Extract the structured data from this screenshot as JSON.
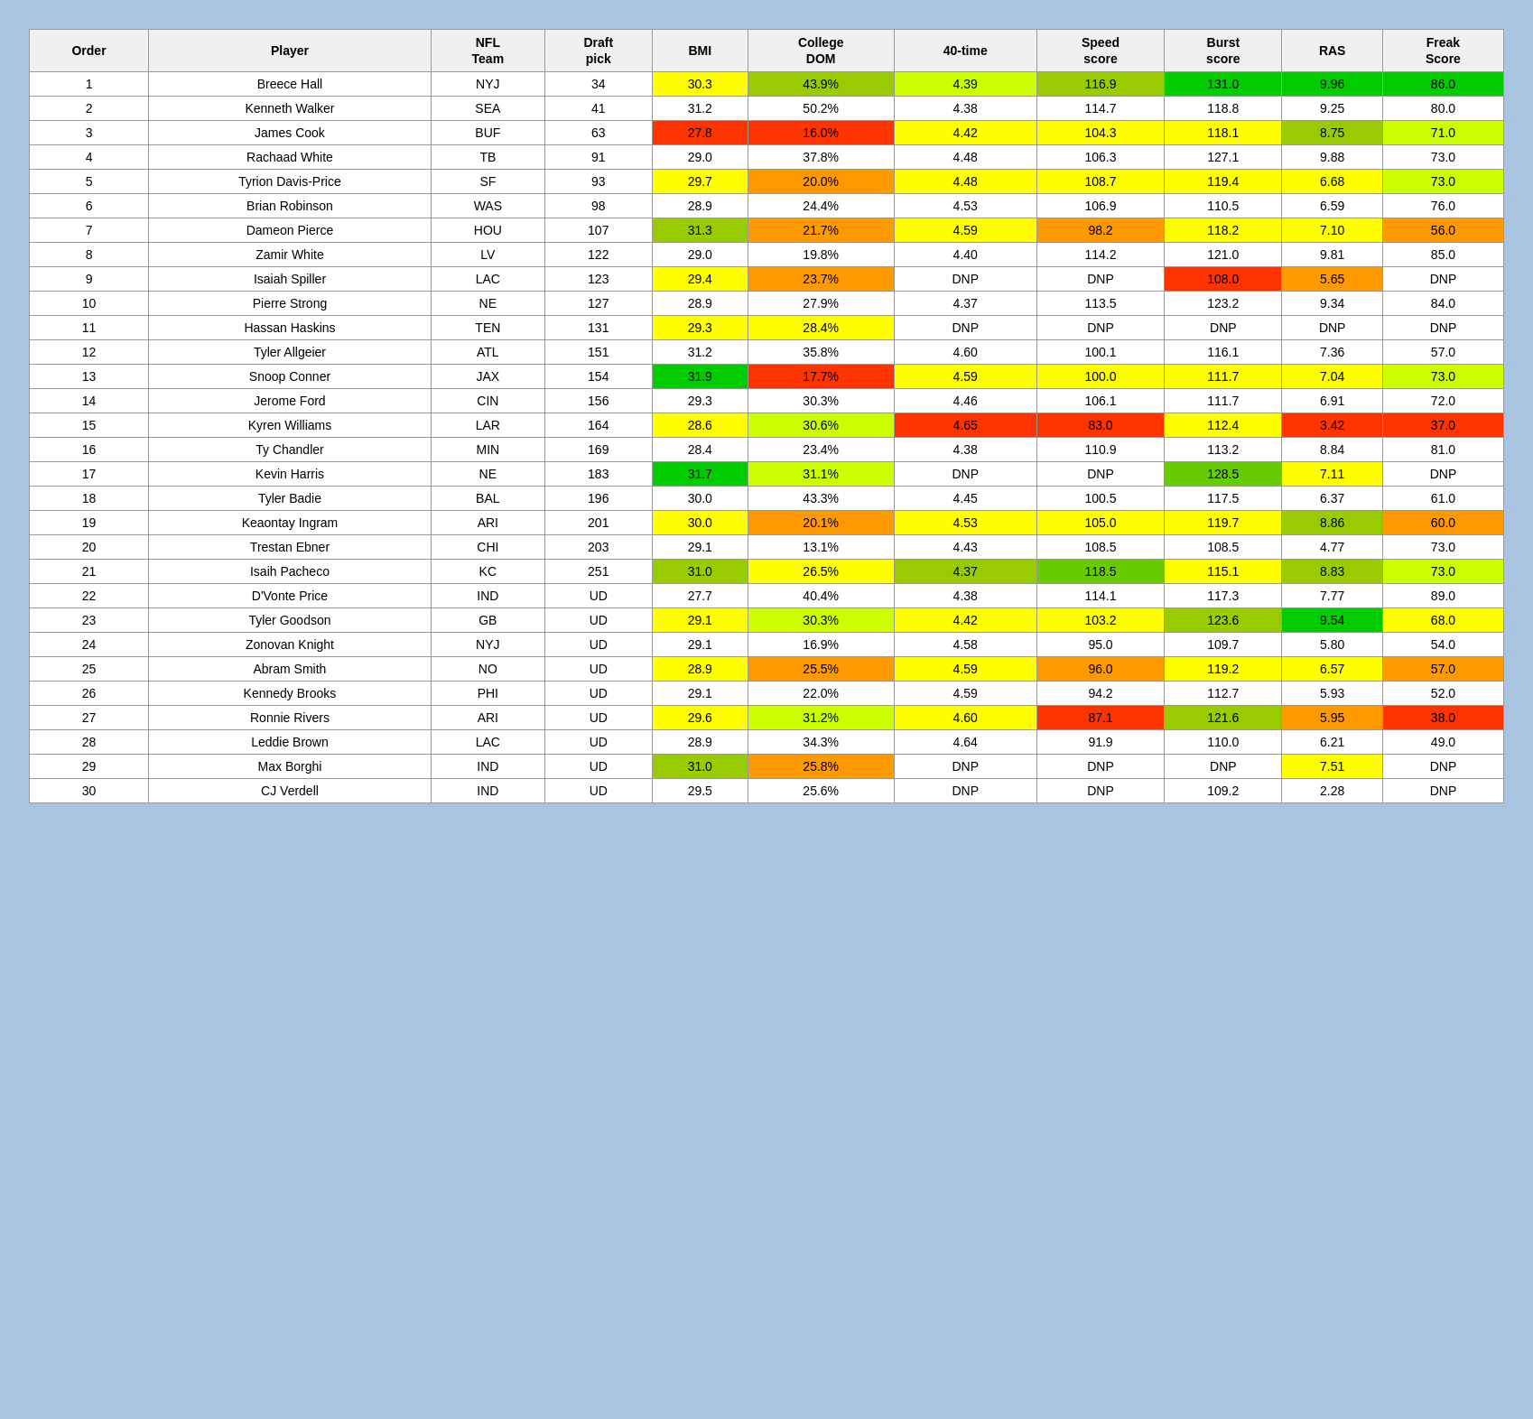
{
  "table": {
    "headers": [
      "Order",
      "Player",
      "NFL Team",
      "Draft pick",
      "BMI",
      "College DOM",
      "40-time",
      "Speed score",
      "Burst score",
      "RAS",
      "Freak Score"
    ],
    "rows": [
      {
        "order": 1,
        "player": "Breece Hall",
        "team": "NYJ",
        "pick": "34",
        "bmi": "30.3",
        "coldom": "43.9%",
        "time40": "4.39",
        "speed": "116.9",
        "burst": "131.0",
        "ras": "9.96",
        "freak": "86.0",
        "bmi_cls": "cell-yellow",
        "coldom_cls": "cell-green-light",
        "time40_cls": "cell-yellow-green",
        "speed_cls": "cell-green-light",
        "burst_cls": "cell-green-strong",
        "ras_cls": "cell-green-strong",
        "freak_cls": "cell-green-strong"
      },
      {
        "order": 2,
        "player": "Kenneth Walker",
        "team": "SEA",
        "pick": "41",
        "bmi": "31.2",
        "coldom": "50.2%",
        "time40": "4.38",
        "speed": "114.7",
        "burst": "118.8",
        "ras": "9.25",
        "freak": "80.0",
        "bmi_cls": "cell-green-light",
        "coldom_cls": "cell-green-strong",
        "time40_cls": "cell-yellow-green",
        "speed_cls": "cell-green-light",
        "burst_cls": "cell-yellow",
        "ras_cls": "cell-green-strong",
        "freak_cls": "cell-green-med"
      },
      {
        "order": 3,
        "player": "James Cook",
        "team": "BUF",
        "pick": "63",
        "bmi": "27.8",
        "coldom": "16.0%",
        "time40": "4.42",
        "speed": "104.3",
        "burst": "118.1",
        "ras": "8.75",
        "freak": "71.0",
        "bmi_cls": "cell-red",
        "coldom_cls": "cell-red",
        "time40_cls": "cell-yellow",
        "speed_cls": "cell-yellow",
        "burst_cls": "cell-yellow",
        "ras_cls": "cell-green-light",
        "freak_cls": "cell-yellow-green"
      },
      {
        "order": 4,
        "player": "Rachaad White",
        "team": "TB",
        "pick": "91",
        "bmi": "29.0",
        "coldom": "37.8%",
        "time40": "4.48",
        "speed": "106.3",
        "burst": "127.1",
        "ras": "9.88",
        "freak": "73.0",
        "bmi_cls": "cell-yellow",
        "coldom_cls": "cell-green-light",
        "time40_cls": "cell-yellow",
        "speed_cls": "cell-yellow",
        "burst_cls": "cell-green-med",
        "ras_cls": "cell-green-strong",
        "freak_cls": "cell-yellow-green"
      },
      {
        "order": 5,
        "player": "Tyrion Davis-Price",
        "team": "SF",
        "pick": "93",
        "bmi": "29.7",
        "coldom": "20.0%",
        "time40": "4.48",
        "speed": "108.7",
        "burst": "119.4",
        "ras": "6.68",
        "freak": "73.0",
        "bmi_cls": "cell-yellow",
        "coldom_cls": "cell-orange",
        "time40_cls": "cell-yellow",
        "speed_cls": "cell-yellow",
        "burst_cls": "cell-yellow",
        "ras_cls": "cell-yellow",
        "freak_cls": "cell-yellow-green"
      },
      {
        "order": 6,
        "player": "Brian Robinson",
        "team": "WAS",
        "pick": "98",
        "bmi": "28.9",
        "coldom": "24.4%",
        "time40": "4.53",
        "speed": "106.9",
        "burst": "110.5",
        "ras": "6.59",
        "freak": "76.0",
        "bmi_cls": "cell-yellow",
        "coldom_cls": "cell-orange",
        "time40_cls": "cell-yellow",
        "speed_cls": "cell-yellow",
        "burst_cls": "cell-yellow",
        "ras_cls": "cell-yellow",
        "freak_cls": "cell-green-light"
      },
      {
        "order": 7,
        "player": "Dameon Pierce",
        "team": "HOU",
        "pick": "107",
        "bmi": "31.3",
        "coldom": "21.7%",
        "time40": "4.59",
        "speed": "98.2",
        "burst": "118.2",
        "ras": "7.10",
        "freak": "56.0",
        "bmi_cls": "cell-green-light",
        "coldom_cls": "cell-orange",
        "time40_cls": "cell-yellow",
        "speed_cls": "cell-orange",
        "burst_cls": "cell-yellow",
        "ras_cls": "cell-yellow",
        "freak_cls": "cell-orange"
      },
      {
        "order": 8,
        "player": "Zamir White",
        "team": "LV",
        "pick": "122",
        "bmi": "29.0",
        "coldom": "19.8%",
        "time40": "4.40",
        "speed": "114.2",
        "burst": "121.0",
        "ras": "9.81",
        "freak": "85.0",
        "bmi_cls": "cell-yellow",
        "coldom_cls": "cell-orange",
        "time40_cls": "cell-yellow-green",
        "speed_cls": "cell-green-light",
        "burst_cls": "cell-green-light",
        "ras_cls": "cell-green-strong",
        "freak_cls": "cell-green-strong"
      },
      {
        "order": 9,
        "player": "Isaiah Spiller",
        "team": "LAC",
        "pick": "123",
        "bmi": "29.4",
        "coldom": "23.7%",
        "time40": "DNP",
        "speed": "DNP",
        "burst": "108.0",
        "ras": "5.65",
        "freak": "DNP",
        "bmi_cls": "cell-yellow",
        "coldom_cls": "cell-orange",
        "time40_cls": "cell-white",
        "speed_cls": "cell-white",
        "burst_cls": "cell-red",
        "ras_cls": "cell-orange",
        "freak_cls": "cell-white"
      },
      {
        "order": 10,
        "player": "Pierre Strong",
        "team": "NE",
        "pick": "127",
        "bmi": "28.9",
        "coldom": "27.9%",
        "time40": "4.37",
        "speed": "113.5",
        "burst": "123.2",
        "ras": "9.34",
        "freak": "84.0",
        "bmi_cls": "cell-yellow",
        "coldom_cls": "cell-yellow",
        "time40_cls": "cell-green-light",
        "speed_cls": "cell-yellow",
        "burst_cls": "cell-green-light",
        "ras_cls": "cell-green-strong",
        "freak_cls": "cell-green-strong"
      },
      {
        "order": 11,
        "player": "Hassan Haskins",
        "team": "TEN",
        "pick": "131",
        "bmi": "29.3",
        "coldom": "28.4%",
        "time40": "DNP",
        "speed": "DNP",
        "burst": "DNP",
        "ras": "DNP",
        "freak": "DNP",
        "bmi_cls": "cell-yellow",
        "coldom_cls": "cell-yellow",
        "time40_cls": "cell-white",
        "speed_cls": "cell-white",
        "burst_cls": "cell-white",
        "ras_cls": "cell-white",
        "freak_cls": "cell-white"
      },
      {
        "order": 12,
        "player": "Tyler Allgeier",
        "team": "ATL",
        "pick": "151",
        "bmi": "31.2",
        "coldom": "35.8%",
        "time40": "4.60",
        "speed": "100.1",
        "burst": "116.1",
        "ras": "7.36",
        "freak": "57.0",
        "bmi_cls": "cell-green-light",
        "coldom_cls": "cell-green-light",
        "time40_cls": "cell-yellow",
        "speed_cls": "cell-yellow",
        "burst_cls": "cell-yellow",
        "ras_cls": "cell-yellow",
        "freak_cls": "cell-orange"
      },
      {
        "order": 13,
        "player": "Snoop Conner",
        "team": "JAX",
        "pick": "154",
        "bmi": "31.9",
        "coldom": "17.7%",
        "time40": "4.59",
        "speed": "100.0",
        "burst": "111.7",
        "ras": "7.04",
        "freak": "73.0",
        "bmi_cls": "cell-green-strong",
        "coldom_cls": "cell-red",
        "time40_cls": "cell-yellow",
        "speed_cls": "cell-yellow",
        "burst_cls": "cell-yellow",
        "ras_cls": "cell-yellow",
        "freak_cls": "cell-yellow-green"
      },
      {
        "order": 14,
        "player": "Jerome Ford",
        "team": "CIN",
        "pick": "156",
        "bmi": "29.3",
        "coldom": "30.3%",
        "time40": "4.46",
        "speed": "106.1",
        "burst": "111.7",
        "ras": "6.91",
        "freak": "72.0",
        "bmi_cls": "cell-yellow",
        "coldom_cls": "cell-yellow-green",
        "time40_cls": "cell-yellow",
        "speed_cls": "cell-yellow",
        "burst_cls": "cell-yellow",
        "ras_cls": "cell-yellow",
        "freak_cls": "cell-yellow-green"
      },
      {
        "order": 15,
        "player": "Kyren Williams",
        "team": "LAR",
        "pick": "164",
        "bmi": "28.6",
        "coldom": "30.6%",
        "time40": "4.65",
        "speed": "83.0",
        "burst": "112.4",
        "ras": "3.42",
        "freak": "37.0",
        "bmi_cls": "cell-yellow",
        "coldom_cls": "cell-yellow-green",
        "time40_cls": "cell-red",
        "speed_cls": "cell-red",
        "burst_cls": "cell-yellow",
        "ras_cls": "cell-red",
        "freak_cls": "cell-red"
      },
      {
        "order": 16,
        "player": "Ty Chandler",
        "team": "MIN",
        "pick": "169",
        "bmi": "28.4",
        "coldom": "23.4%",
        "time40": "4.38",
        "speed": "110.9",
        "burst": "113.2",
        "ras": "8.84",
        "freak": "81.0",
        "bmi_cls": "cell-orange",
        "coldom_cls": "cell-orange",
        "time40_cls": "cell-yellow-green",
        "speed_cls": "cell-yellow",
        "burst_cls": "cell-yellow",
        "ras_cls": "cell-green-light",
        "freak_cls": "cell-green-strong"
      },
      {
        "order": 17,
        "player": "Kevin Harris",
        "team": "NE",
        "pick": "183",
        "bmi": "31.7",
        "coldom": "31.1%",
        "time40": "DNP",
        "speed": "DNP",
        "burst": "128.5",
        "ras": "7.11",
        "freak": "DNP",
        "bmi_cls": "cell-green-strong",
        "coldom_cls": "cell-yellow-green",
        "time40_cls": "cell-white",
        "speed_cls": "cell-white",
        "burst_cls": "cell-green-med",
        "ras_cls": "cell-yellow",
        "freak_cls": "cell-white"
      },
      {
        "order": 18,
        "player": "Tyler Badie",
        "team": "BAL",
        "pick": "196",
        "bmi": "30.0",
        "coldom": "43.3%",
        "time40": "4.45",
        "speed": "100.5",
        "burst": "117.5",
        "ras": "6.37",
        "freak": "61.0",
        "bmi_cls": "cell-yellow",
        "coldom_cls": "cell-green-light",
        "time40_cls": "cell-yellow",
        "speed_cls": "cell-yellow",
        "burst_cls": "cell-yellow",
        "ras_cls": "cell-yellow",
        "freak_cls": "cell-orange"
      },
      {
        "order": 19,
        "player": "Keaontay Ingram",
        "team": "ARI",
        "pick": "201",
        "bmi": "30.0",
        "coldom": "20.1%",
        "time40": "4.53",
        "speed": "105.0",
        "burst": "119.7",
        "ras": "8.86",
        "freak": "60.0",
        "bmi_cls": "cell-yellow",
        "coldom_cls": "cell-orange",
        "time40_cls": "cell-yellow",
        "speed_cls": "cell-yellow",
        "burst_cls": "cell-yellow",
        "ras_cls": "cell-green-light",
        "freak_cls": "cell-orange"
      },
      {
        "order": 20,
        "player": "Trestan Ebner",
        "team": "CHI",
        "pick": "203",
        "bmi": "29.1",
        "coldom": "13.1%",
        "time40": "4.43",
        "speed": "108.5",
        "burst": "108.5",
        "ras": "4.77",
        "freak": "73.0",
        "bmi_cls": "cell-yellow",
        "coldom_cls": "cell-red",
        "time40_cls": "cell-yellow",
        "speed_cls": "cell-yellow",
        "burst_cls": "cell-red-light",
        "ras_cls": "cell-orange",
        "freak_cls": "cell-yellow-green"
      },
      {
        "order": 21,
        "player": "Isaih Pacheco",
        "team": "KC",
        "pick": "251",
        "bmi": "31.0",
        "coldom": "26.5%",
        "time40": "4.37",
        "speed": "118.5",
        "burst": "115.1",
        "ras": "8.83",
        "freak": "73.0",
        "bmi_cls": "cell-green-light",
        "coldom_cls": "cell-yellow",
        "time40_cls": "cell-green-light",
        "speed_cls": "cell-green-med",
        "burst_cls": "cell-yellow",
        "ras_cls": "cell-green-light",
        "freak_cls": "cell-yellow-green"
      },
      {
        "order": 22,
        "player": "D'Vonte Price",
        "team": "IND",
        "pick": "UD",
        "bmi": "27.7",
        "coldom": "40.4%",
        "time40": "4.38",
        "speed": "114.1",
        "burst": "117.3",
        "ras": "7.77",
        "freak": "89.0",
        "bmi_cls": "cell-red",
        "coldom_cls": "cell-green-light",
        "time40_cls": "cell-yellow-green",
        "speed_cls": "cell-green-light",
        "burst_cls": "cell-yellow",
        "ras_cls": "cell-yellow",
        "freak_cls": "cell-green-strong"
      },
      {
        "order": 23,
        "player": "Tyler Goodson",
        "team": "GB",
        "pick": "UD",
        "bmi": "29.1",
        "coldom": "30.3%",
        "time40": "4.42",
        "speed": "103.2",
        "burst": "123.6",
        "ras": "9.54",
        "freak": "68.0",
        "bmi_cls": "cell-yellow",
        "coldom_cls": "cell-yellow-green",
        "time40_cls": "cell-yellow",
        "speed_cls": "cell-yellow",
        "burst_cls": "cell-green-light",
        "ras_cls": "cell-green-strong",
        "freak_cls": "cell-yellow"
      },
      {
        "order": 24,
        "player": "Zonovan Knight",
        "team": "NYJ",
        "pick": "UD",
        "bmi": "29.1",
        "coldom": "16.9%",
        "time40": "4.58",
        "speed": "95.0",
        "burst": "109.7",
        "ras": "5.80",
        "freak": "54.0",
        "bmi_cls": "cell-yellow",
        "coldom_cls": "cell-red",
        "time40_cls": "cell-yellow",
        "speed_cls": "cell-orange",
        "burst_cls": "cell-orange",
        "ras_cls": "cell-orange",
        "freak_cls": "cell-orange"
      },
      {
        "order": 25,
        "player": "Abram Smith",
        "team": "NO",
        "pick": "UD",
        "bmi": "28.9",
        "coldom": "25.5%",
        "time40": "4.59",
        "speed": "96.0",
        "burst": "119.2",
        "ras": "6.57",
        "freak": "57.0",
        "bmi_cls": "cell-yellow",
        "coldom_cls": "cell-orange",
        "time40_cls": "cell-yellow",
        "speed_cls": "cell-orange",
        "burst_cls": "cell-yellow",
        "ras_cls": "cell-yellow",
        "freak_cls": "cell-orange"
      },
      {
        "order": 26,
        "player": "Kennedy Brooks",
        "team": "PHI",
        "pick": "UD",
        "bmi": "29.1",
        "coldom": "22.0%",
        "time40": "4.59",
        "speed": "94.2",
        "burst": "112.7",
        "ras": "5.93",
        "freak": "52.0",
        "bmi_cls": "cell-yellow",
        "coldom_cls": "cell-orange",
        "time40_cls": "cell-yellow",
        "speed_cls": "cell-red-light",
        "burst_cls": "cell-yellow",
        "ras_cls": "cell-orange",
        "freak_cls": "cell-orange"
      },
      {
        "order": 27,
        "player": "Ronnie Rivers",
        "team": "ARI",
        "pick": "UD",
        "bmi": "29.6",
        "coldom": "31.2%",
        "time40": "4.60",
        "speed": "87.1",
        "burst": "121.6",
        "ras": "5.95",
        "freak": "38.0",
        "bmi_cls": "cell-yellow",
        "coldom_cls": "cell-yellow-green",
        "time40_cls": "cell-yellow",
        "speed_cls": "cell-red",
        "burst_cls": "cell-green-light",
        "ras_cls": "cell-orange",
        "freak_cls": "cell-red"
      },
      {
        "order": 28,
        "player": "Leddie Brown",
        "team": "LAC",
        "pick": "UD",
        "bmi": "28.9",
        "coldom": "34.3%",
        "time40": "4.64",
        "speed": "91.9",
        "burst": "110.0",
        "ras": "6.21",
        "freak": "49.0",
        "bmi_cls": "cell-yellow",
        "coldom_cls": "cell-green-light",
        "time40_cls": "cell-red-light",
        "speed_cls": "cell-red-light",
        "burst_cls": "cell-yellow",
        "ras_cls": "cell-yellow",
        "freak_cls": "cell-orange"
      },
      {
        "order": 29,
        "player": "Max Borghi",
        "team": "IND",
        "pick": "UD",
        "bmi": "31.0",
        "coldom": "25.8%",
        "time40": "DNP",
        "speed": "DNP",
        "burst": "DNP",
        "ras": "7.51",
        "freak": "DNP",
        "bmi_cls": "cell-green-light",
        "coldom_cls": "cell-orange",
        "time40_cls": "cell-white",
        "speed_cls": "cell-white",
        "burst_cls": "cell-white",
        "ras_cls": "cell-yellow",
        "freak_cls": "cell-white"
      },
      {
        "order": 30,
        "player": "CJ Verdell",
        "team": "IND",
        "pick": "UD",
        "bmi": "29.5",
        "coldom": "25.6%",
        "time40": "DNP",
        "speed": "DNP",
        "burst": "109.2",
        "ras": "2.28",
        "freak": "DNP",
        "bmi_cls": "cell-yellow",
        "coldom_cls": "cell-orange",
        "time40_cls": "cell-white",
        "speed_cls": "cell-white",
        "burst_cls": "cell-red",
        "ras_cls": "cell-red",
        "freak_cls": "cell-white"
      }
    ]
  }
}
